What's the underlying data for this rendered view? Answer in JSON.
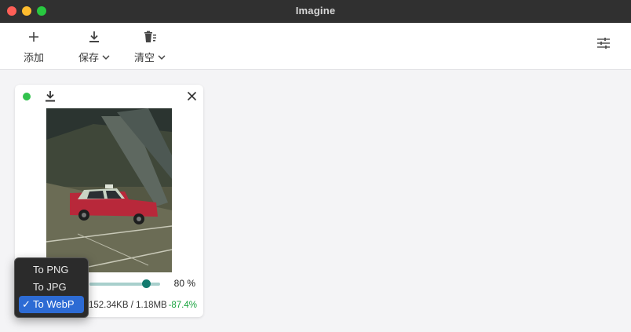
{
  "window": {
    "title": "Imagine"
  },
  "toolbar": {
    "add_label": "添加",
    "save_label": "保存",
    "clear_label": "清空"
  },
  "card": {
    "quality_value": 80,
    "quality_text": "80 %",
    "sizes_text": "152.34KB / 1.18MB",
    "saving_text": "-87.4%"
  },
  "format_menu": {
    "items": [
      {
        "label": "To PNG",
        "selected": false
      },
      {
        "label": "To JPG",
        "selected": false
      },
      {
        "label": "To WebP",
        "selected": true
      }
    ],
    "check_glyph": "✓"
  },
  "colors": {
    "accent": "#127a6e",
    "saving": "#18a33e",
    "status": "#32c24d",
    "menu_highlight": "#2d6bd4"
  }
}
